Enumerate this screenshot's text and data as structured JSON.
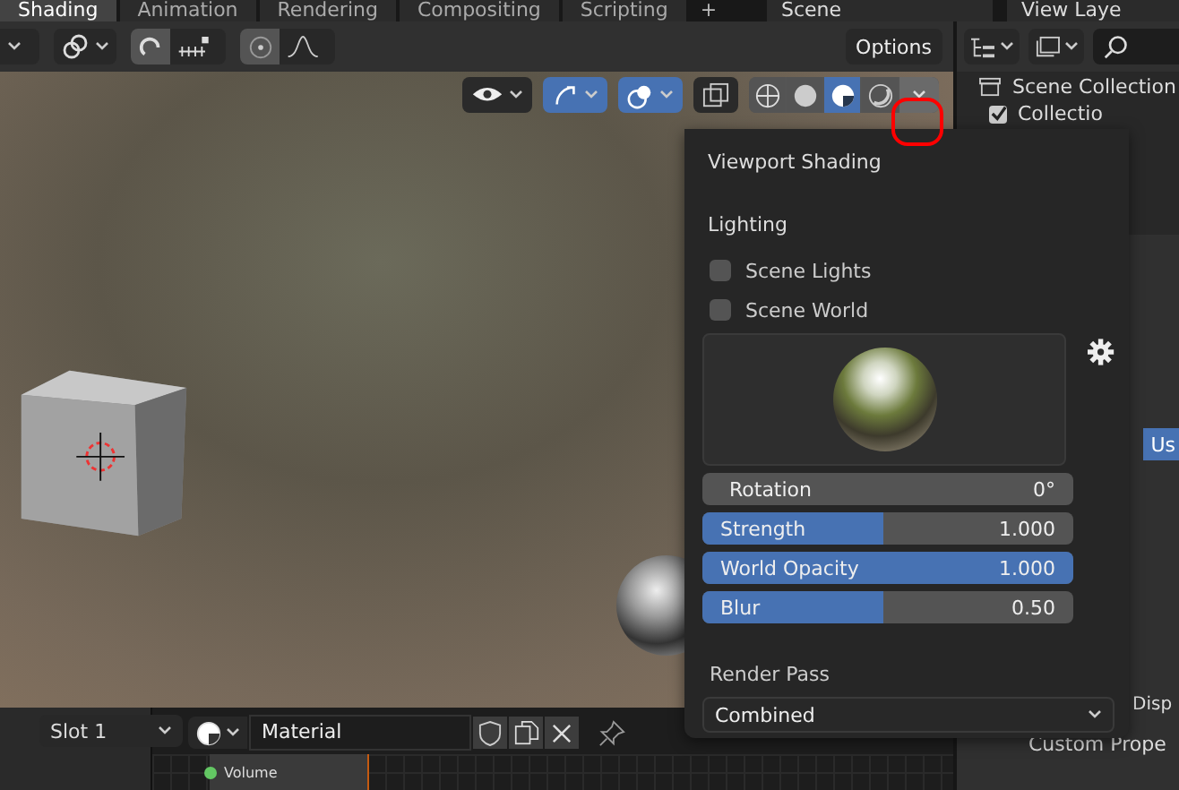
{
  "top_tabs": [
    {
      "label": "Shading",
      "selected": true
    },
    {
      "label": "Animation",
      "selected": false
    },
    {
      "label": "Rendering",
      "selected": false
    },
    {
      "label": "Compositing",
      "selected": false
    },
    {
      "label": "Scripting",
      "selected": false
    }
  ],
  "add_tab": "+",
  "scene_field": "Scene",
  "view_layer_field": "View Laye",
  "header_toggles": [
    {
      "kind": "snap",
      "on": true
    },
    {
      "kind": "proportional",
      "on": true
    }
  ],
  "options_button": "Options",
  "viewport_toggles": [
    {
      "kind": "visibility",
      "on": false
    },
    {
      "kind": "gizmo",
      "on": true
    },
    {
      "kind": "overlay",
      "on": true
    },
    {
      "kind": "xray",
      "on": false
    }
  ],
  "shading_modes": [
    {
      "kind": "wireframe",
      "selected": false
    },
    {
      "kind": "solid",
      "selected": false
    },
    {
      "kind": "material",
      "selected": true
    },
    {
      "kind": "rendered",
      "selected": false
    }
  ],
  "popup": {
    "title": "Viewport Shading",
    "section": "Lighting",
    "checkboxes": [
      {
        "label": "Scene Lights",
        "checked": false
      },
      {
        "label": "Scene World",
        "checked": false
      }
    ],
    "fields": [
      {
        "kind": "field",
        "label": "Rotation",
        "value": "0°"
      },
      {
        "kind": "slider",
        "label": "Strength",
        "value": "1.000",
        "level": 0.49
      },
      {
        "kind": "slider",
        "label": "World Opacity",
        "value": "1.000",
        "level": 1
      },
      {
        "kind": "slider",
        "label": "Blur",
        "value": "0.50",
        "level": 0.49
      }
    ],
    "render_pass_label": "Render Pass",
    "render_pass": "Combined"
  },
  "outliner": {
    "root": "Scene Collection",
    "children": [
      {
        "label": "Collectio",
        "checked": true
      }
    ]
  },
  "properties": {
    "button": "Us",
    "items": [
      "Disp",
      "Custom Prope"
    ]
  },
  "material_bar": {
    "slot": "Slot 1",
    "material": "Material"
  },
  "node_sockets": [
    "Volume"
  ]
}
